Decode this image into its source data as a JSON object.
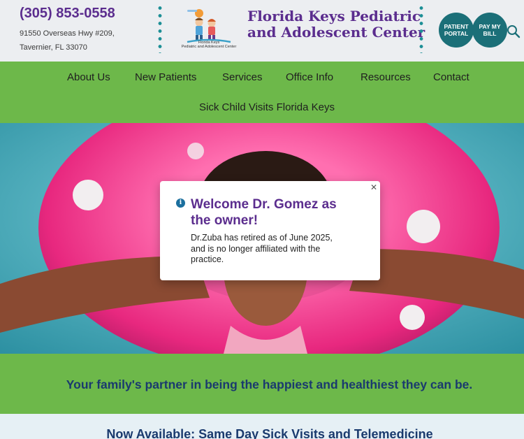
{
  "header": {
    "phone": "(305) 853-0558",
    "address_line1": "91550 Overseas Hwy #209,",
    "address_line2": "Tavernier, FL 33070",
    "brand_line1": "Florida Keys Pediatric",
    "brand_line2": "and Adolescent Center",
    "logo_caption_line1": "Florida Keys",
    "logo_caption_line2": "Pediatric and Adolescent Center",
    "patient_portal_label": "PATIENT PORTAL",
    "pay_bill_label": "PAY MY BILL",
    "search_icon": "search-icon"
  },
  "nav": {
    "items": [
      "About Us",
      "New Patients",
      "Services",
      "Office Info",
      "Resources",
      "Contact",
      "Sick Child Visits Florida Keys"
    ]
  },
  "modal": {
    "title": "Welcome Dr. Gomez as the owner!",
    "body": "Dr.Zuba has retired as of June 2025, and is no longer affiliated with the practice.",
    "close_icon": "close-icon",
    "info_icon": "info-icon"
  },
  "tagline": "Your family's partner in being the happiest and healthiest they can be.",
  "bottom_heading": "Now Available: Same Day Sick Visits and Telemedicine",
  "colors": {
    "brand_purple": "#5b2d8e",
    "nav_green": "#6db84a",
    "teal": "#1b6f78",
    "navy": "#1a3a6e"
  }
}
